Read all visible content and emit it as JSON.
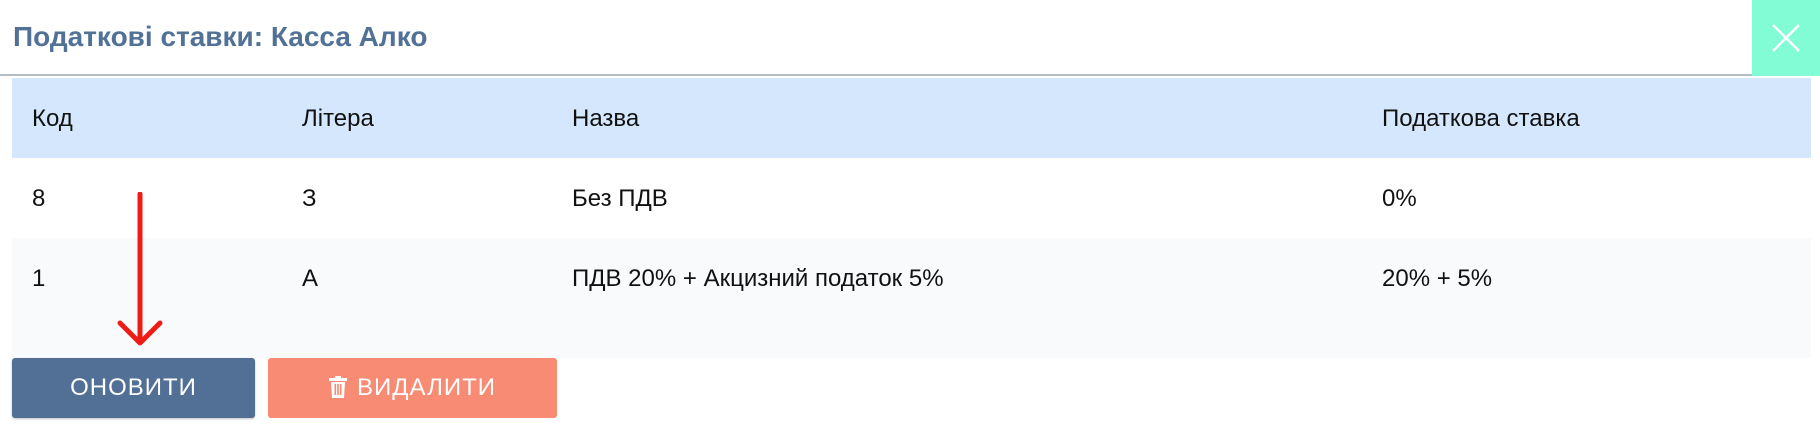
{
  "dialog": {
    "title": "Податкові ставки: Касса Алко",
    "close_icon": "close-x-icon",
    "accent_color": "#82fcd4"
  },
  "table": {
    "headers": {
      "code": "Код",
      "letter": "Літера",
      "name": "Назва",
      "rate": "Податкова ставка"
    },
    "rows": [
      {
        "code": "8",
        "letter": "З",
        "name": "Без ПДВ",
        "rate": "0%"
      },
      {
        "code": "1",
        "letter": "А",
        "name": "ПДВ 20% + Акцизний податок 5%",
        "rate": "20% + 5%"
      }
    ]
  },
  "actions": {
    "update_label": "ОНОВИТИ",
    "delete_label": "ВИДАЛИТИ",
    "delete_icon": "trash-icon",
    "update_color": "#527096",
    "delete_color": "#f78b73"
  },
  "annotation": {
    "arrow_icon": "red-arrow-down-icon",
    "arrow_color": "#ee1c14"
  }
}
